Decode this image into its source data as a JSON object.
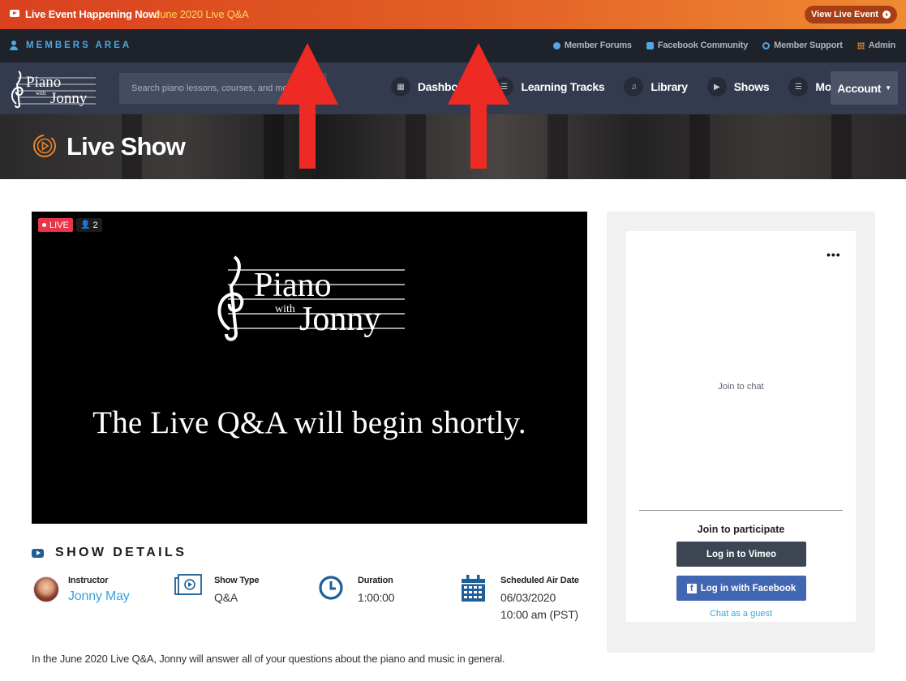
{
  "banner": {
    "message": "Live Event Happening Now!",
    "event_name": "June 2020 Live Q&A",
    "view_button": "View Live Event"
  },
  "members_bar": {
    "label": "MEMBERS AREA",
    "links": [
      "Member Forums",
      "Facebook Community",
      "Member Support",
      "Admin"
    ]
  },
  "nav": {
    "logo_text_1": "Piano",
    "logo_text_2": "with",
    "logo_text_3": "Jonny",
    "search_placeholder": "Search piano lessons, courses, and more...",
    "items": [
      "Dashboard",
      "Learning Tracks",
      "Library",
      "Shows",
      "More"
    ],
    "account": "Account"
  },
  "hero": {
    "title": "Live Show"
  },
  "video": {
    "live_label": "LIVE",
    "viewer_count": "2",
    "logo_text_1": "Piano",
    "logo_text_2": "with",
    "logo_text_3": "Jonny",
    "message": "The Live Q&A will begin shortly."
  },
  "show_details": {
    "heading": "SHOW DETAILS",
    "instructor_label": "Instructor",
    "instructor_name": "Jonny May",
    "type_label": "Show Type",
    "type_value": "Q&A",
    "duration_label": "Duration",
    "duration_value": "1:00:00",
    "date_label": "Scheduled Air Date",
    "date_value": "06/03/2020",
    "time_value": "10:00 am (PST)",
    "description": "In the June 2020 Live Q&A, Jonny will answer all of your questions about the piano and music in general."
  },
  "chat": {
    "more": "•••",
    "join_chat": "Join to chat",
    "join_participate": "Join to participate",
    "vimeo_button": "Log in to Vimeo",
    "facebook_button": "Log in with Facebook",
    "guest_link": "Chat as a guest"
  },
  "colors": {
    "banner_start": "#d9411f",
    "banner_end": "#ef8a34",
    "accent_blue": "#3aa4d8",
    "nav_bg": "#353b4e",
    "live_red": "#e8354a",
    "arrow_red": "#ee2a24"
  }
}
